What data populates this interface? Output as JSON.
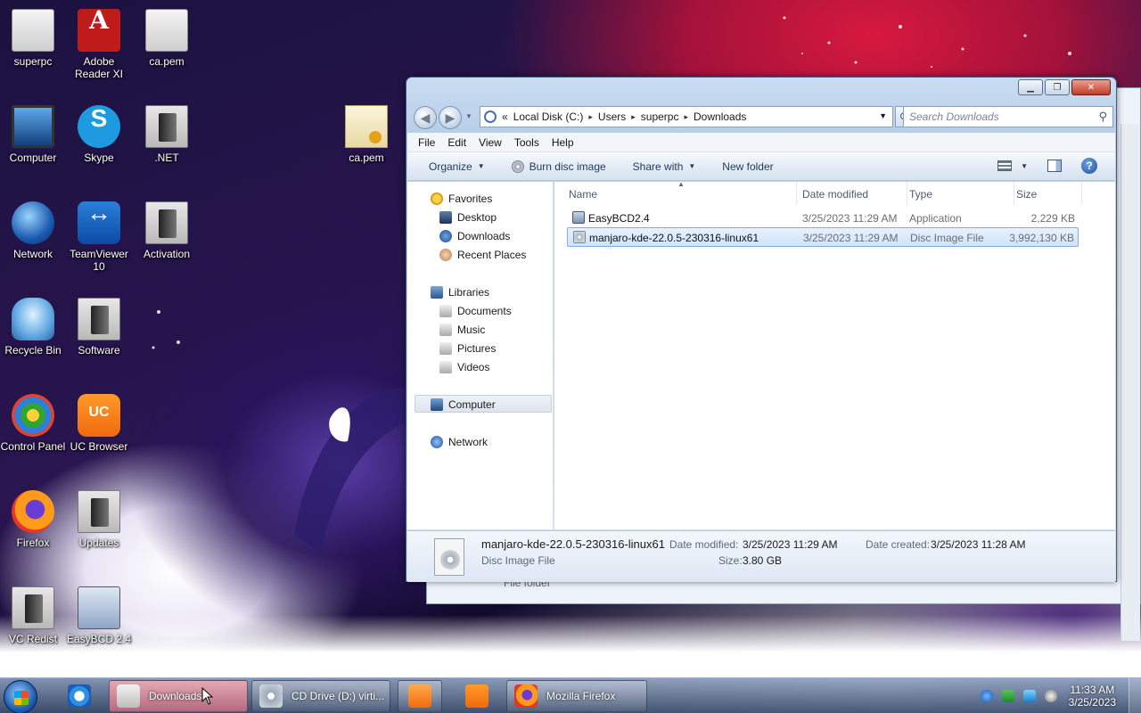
{
  "desktop": {
    "icons": [
      {
        "label": "superpc"
      },
      {
        "label": "Adobe Reader XI"
      },
      {
        "label": "ca.pem"
      },
      {
        "label": "Computer"
      },
      {
        "label": "Skype"
      },
      {
        "label": ".NET"
      },
      {
        "label": "ca.pem"
      },
      {
        "label": "Network"
      },
      {
        "label": "TeamViewer 10"
      },
      {
        "label": "Activation"
      },
      {
        "label": "Recycle Bin"
      },
      {
        "label": "Software"
      },
      {
        "label": "Control Panel"
      },
      {
        "label": "UC Browser"
      },
      {
        "label": "Firefox"
      },
      {
        "label": "Updates"
      },
      {
        "label": "VC Redist"
      },
      {
        "label": "EasyBCD 2.4"
      }
    ],
    "ghost_text": "File folder"
  },
  "explorer": {
    "caption": {
      "minimize": "▁",
      "maximize": "❐",
      "close": "✕"
    },
    "address": {
      "prefix": "«",
      "segments": [
        "Local Disk (C:)",
        "Users",
        "superpc",
        "Downloads"
      ],
      "separator": "▸"
    },
    "search_placeholder": "Search Downloads",
    "menu": [
      "File",
      "Edit",
      "View",
      "Tools",
      "Help"
    ],
    "toolbar": {
      "organize": "Organize",
      "burn": "Burn disc image",
      "share": "Share with",
      "new_folder": "New folder"
    },
    "nav": {
      "favorites": "Favorites",
      "favorites_items": [
        "Desktop",
        "Downloads",
        "Recent Places"
      ],
      "libraries": "Libraries",
      "libraries_items": [
        "Documents",
        "Music",
        "Pictures",
        "Videos"
      ],
      "computer": "Computer",
      "network": "Network"
    },
    "columns": {
      "name": "Name",
      "date": "Date modified",
      "type": "Type",
      "size": "Size"
    },
    "files": [
      {
        "name": "EasyBCD2.4",
        "date": "3/25/2023 11:29 AM",
        "type": "Application",
        "size": "2,229 KB",
        "icon": "application-icon"
      },
      {
        "name": "manjaro-kde-22.0.5-230316-linux61",
        "date": "3/25/2023 11:29 AM",
        "type": "Disc Image File",
        "size": "3,992,130 KB",
        "icon": "disc-image-icon",
        "selected": true
      }
    ],
    "details": {
      "name": "manjaro-kde-22.0.5-230316-linux61",
      "type": "Disc Image File",
      "date_modified_label": "Date modified:",
      "date_modified": "3/25/2023 11:29 AM",
      "date_created_label": "Date created:",
      "date_created": "3/25/2023 11:28 AM",
      "size_label": "Size:",
      "size": "3.80 GB"
    }
  },
  "taskbar": {
    "buttons": [
      {
        "label": "Downloads",
        "icon": "explorer-icon"
      },
      {
        "label": "CD Drive (D:) virti...",
        "icon": "cd-drive-icon"
      },
      {
        "label": "Mozilla Firefox",
        "icon": "firefox-icon"
      }
    ],
    "clock": {
      "time": "11:33 AM",
      "date": "3/25/2023"
    }
  }
}
